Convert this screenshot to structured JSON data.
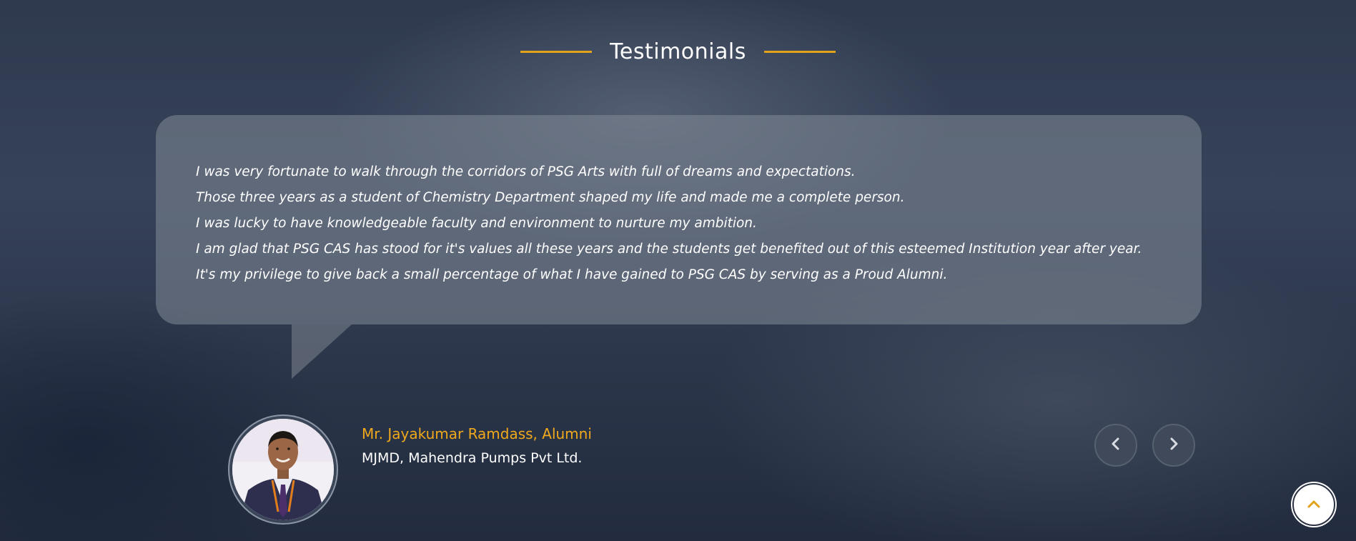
{
  "section": {
    "title": "Testimonials"
  },
  "testimonial": {
    "lines": [
      "I was very fortunate to walk through the corridors of PSG Arts with full of dreams and expectations.",
      "Those three years as a student of Chemistry Department shaped my life and made me a complete person.",
      "I was lucky to have knowledgeable faculty and environment to nurture my ambition.",
      "I am glad that PSG CAS has stood for it's values all these years and the students get benefited out of this esteemed Institution year after year.",
      "It's my privilege to give back a small percentage of what I have gained to PSG CAS by serving as a Proud Alumni."
    ],
    "author_name": "Mr. Jayakumar Ramdass, Alumni",
    "author_title": "MJMD, Mahendra Pumps Pvt Ltd."
  },
  "controls": {
    "prev_icon": "chevron-left-icon",
    "next_icon": "chevron-right-icon",
    "to_top_icon": "chevron-up-icon"
  },
  "colors": {
    "accent": "#e2a21a",
    "author_name": "#f0a81c",
    "text": "#ffffff"
  }
}
